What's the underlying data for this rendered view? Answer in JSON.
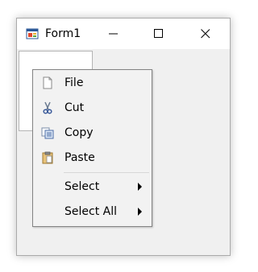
{
  "window": {
    "title": "Form1"
  },
  "context_menu": {
    "items": [
      {
        "label": "File",
        "icon": "document-icon",
        "submenu": false
      },
      {
        "label": "Cut",
        "icon": "scissors-icon",
        "submenu": false
      },
      {
        "label": "Copy",
        "icon": "copy-icon",
        "submenu": false
      },
      {
        "label": "Paste",
        "icon": "clipboard-icon",
        "submenu": false
      },
      {
        "label": "Select",
        "icon": null,
        "submenu": true
      },
      {
        "label": "Select All",
        "icon": null,
        "submenu": true
      }
    ]
  },
  "colors": {
    "titlebar": "#ffffff",
    "client": "#f0f0f0",
    "menu": "#f2f2f2",
    "menu_border": "#838383"
  }
}
